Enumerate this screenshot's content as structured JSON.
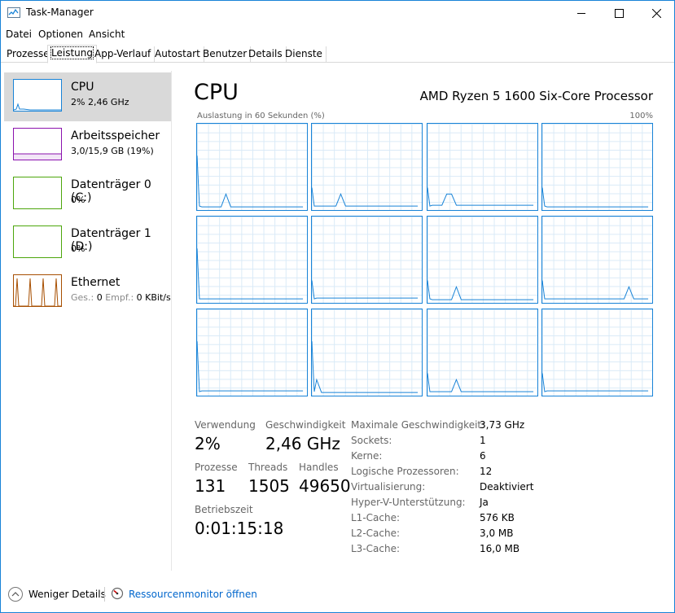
{
  "window": {
    "title": "Task-Manager"
  },
  "menu": [
    "Datei",
    "Optionen",
    "Ansicht"
  ],
  "tabs": [
    "Prozesse",
    "Leistung",
    "App-Verlauf",
    "Autostart",
    "Benutzer",
    "Details",
    "Dienste"
  ],
  "active_tab": "Leistung",
  "sidebar": [
    {
      "title": "CPU",
      "sub": "2% 2,46 GHz",
      "selected": true
    },
    {
      "title": "Arbeitsspeicher",
      "sub": "3,0/15,9 GB (19%)"
    },
    {
      "title": "Datenträger 0 (C:)",
      "sub": "0%"
    },
    {
      "title": "Datenträger 1 (D:)",
      "sub": "0%"
    },
    {
      "title": "Ethernet",
      "sub_send_label": "Ges.:",
      "sub_send_val": "0",
      "sub_recv_label": "Empf.:",
      "sub_recv_val": "0 KBit/s"
    }
  ],
  "main": {
    "title": "CPU",
    "model": "AMD Ryzen 5 1600 Six-Core Processor",
    "graph_caption": "Auslastung in 60 Sekunden (%)",
    "graph_max": "100%",
    "logical_processor_graphs": 12
  },
  "stats": {
    "usage_label": "Verwendung",
    "usage_value": "2%",
    "speed_label": "Geschwindigkeit",
    "speed_value": "2,46 GHz",
    "processes_label": "Prozesse",
    "processes_value": "131",
    "threads_label": "Threads",
    "threads_value": "1505",
    "handles_label": "Handles",
    "handles_value": "49650",
    "uptime_label": "Betriebszeit",
    "uptime_value": "0:01:15:18"
  },
  "details": [
    {
      "label": "Maximale Geschwindigkeit:",
      "value": "3,73 GHz"
    },
    {
      "label": "Sockets:",
      "value": "1"
    },
    {
      "label": "Kerne:",
      "value": "6"
    },
    {
      "label": "Logische Prozessoren:",
      "value": "12"
    },
    {
      "label": "Virtualisierung:",
      "value": "Deaktiviert"
    },
    {
      "label": "Hyper-V-Unterstützung:",
      "value": "Ja"
    },
    {
      "label": "L1-Cache:",
      "value": "576 KB"
    },
    {
      "label": "L2-Cache:",
      "value": "3,0 MB"
    },
    {
      "label": "L3-Cache:",
      "value": "16,0 MB"
    }
  ],
  "footer": {
    "fewer_details": "Weniger Details",
    "resource_monitor": "Ressourcenmonitor öffnen"
  },
  "colors": {
    "cpu": "#1883d7",
    "memory": "#8b12ae",
    "disk": "#4da60c",
    "ethernet": "#a74f01",
    "link": "#0066cc"
  },
  "icons": [
    "taskmanager-icon",
    "minimize-icon",
    "maximize-icon",
    "close-icon",
    "chevron-up-icon",
    "resource-monitor-icon"
  ]
}
